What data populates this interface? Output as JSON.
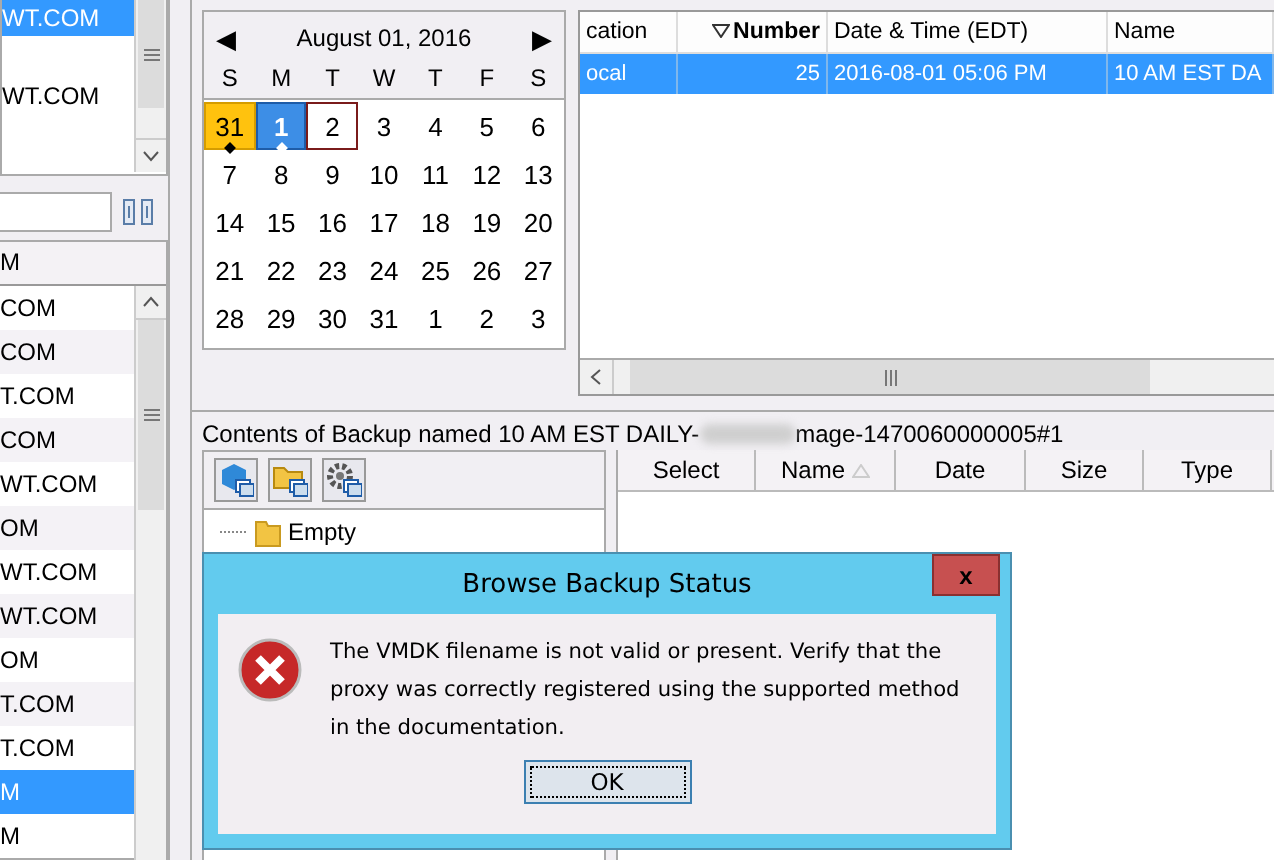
{
  "top_list": {
    "items": [
      {
        "text": "WT.COM",
        "selected": true
      },
      {
        "text": "WT.COM",
        "selected": false
      }
    ]
  },
  "side_table": {
    "columns": [
      "M"
    ],
    "rows": [
      {
        "text": "COM",
        "selected": false
      },
      {
        "text": "COM",
        "selected": false
      },
      {
        "text": "T.COM",
        "selected": false
      },
      {
        "text": "COM",
        "selected": false
      },
      {
        "text": "WT.COM",
        "selected": false
      },
      {
        "text": "OM",
        "selected": false
      },
      {
        "text": "WT.COM",
        "selected": false
      },
      {
        "text": "WT.COM",
        "selected": false
      },
      {
        "text": "OM",
        "selected": false
      },
      {
        "text": "T.COM",
        "selected": false
      },
      {
        "text": "T.COM",
        "selected": false
      },
      {
        "text": "M",
        "selected": true
      },
      {
        "text": "M",
        "selected": false
      }
    ]
  },
  "calendar": {
    "prev": "◀",
    "title": "August 01, 2016",
    "next": "▶",
    "weekdays": [
      "S",
      "M",
      "T",
      "W",
      "T",
      "F",
      "S"
    ],
    "days": [
      {
        "text": "31",
        "selected": false,
        "has_backup": true,
        "today": false
      },
      {
        "text": "1",
        "selected": true,
        "has_backup": true,
        "today": false
      },
      {
        "text": "2",
        "selected": false,
        "has_backup": false,
        "today": true
      },
      {
        "text": "3",
        "selected": false,
        "has_backup": false,
        "today": false
      },
      {
        "text": "4",
        "selected": false,
        "has_backup": false,
        "today": false
      },
      {
        "text": "5",
        "selected": false,
        "has_backup": false,
        "today": false
      },
      {
        "text": "6",
        "selected": false,
        "has_backup": false,
        "today": false
      },
      {
        "text": "7",
        "selected": false,
        "has_backup": false,
        "today": false
      },
      {
        "text": "8",
        "selected": false,
        "has_backup": false,
        "today": false
      },
      {
        "text": "9",
        "selected": false,
        "has_backup": false,
        "today": false
      },
      {
        "text": "10",
        "selected": false,
        "has_backup": false,
        "today": false
      },
      {
        "text": "11",
        "selected": false,
        "has_backup": false,
        "today": false
      },
      {
        "text": "12",
        "selected": false,
        "has_backup": false,
        "today": false
      },
      {
        "text": "13",
        "selected": false,
        "has_backup": false,
        "today": false
      },
      {
        "text": "14",
        "selected": false,
        "has_backup": false,
        "today": false
      },
      {
        "text": "15",
        "selected": false,
        "has_backup": false,
        "today": false
      },
      {
        "text": "16",
        "selected": false,
        "has_backup": false,
        "today": false
      },
      {
        "text": "17",
        "selected": false,
        "has_backup": false,
        "today": false
      },
      {
        "text": "18",
        "selected": false,
        "has_backup": false,
        "today": false
      },
      {
        "text": "19",
        "selected": false,
        "has_backup": false,
        "today": false
      },
      {
        "text": "20",
        "selected": false,
        "has_backup": false,
        "today": false
      },
      {
        "text": "21",
        "selected": false,
        "has_backup": false,
        "today": false
      },
      {
        "text": "22",
        "selected": false,
        "has_backup": false,
        "today": false
      },
      {
        "text": "23",
        "selected": false,
        "has_backup": false,
        "today": false
      },
      {
        "text": "24",
        "selected": false,
        "has_backup": false,
        "today": false
      },
      {
        "text": "25",
        "selected": false,
        "has_backup": false,
        "today": false
      },
      {
        "text": "26",
        "selected": false,
        "has_backup": false,
        "today": false
      },
      {
        "text": "27",
        "selected": false,
        "has_backup": false,
        "today": false
      },
      {
        "text": "28",
        "selected": false,
        "has_backup": false,
        "today": false
      },
      {
        "text": "29",
        "selected": false,
        "has_backup": false,
        "today": false
      },
      {
        "text": "30",
        "selected": false,
        "has_backup": false,
        "today": false
      },
      {
        "text": "31",
        "selected": false,
        "has_backup": false,
        "today": false
      },
      {
        "text": "1",
        "selected": false,
        "has_backup": false,
        "today": false
      },
      {
        "text": "2",
        "selected": false,
        "has_backup": false,
        "today": false
      },
      {
        "text": "3",
        "selected": false,
        "has_backup": false,
        "today": false
      }
    ]
  },
  "backups_table": {
    "columns": [
      {
        "label": "cation",
        "kind": "plain"
      },
      {
        "label": "Number",
        "kind": "sort-desc"
      },
      {
        "label": "Date & Time (EDT)",
        "kind": "plain"
      },
      {
        "label": "Name",
        "kind": "plain"
      }
    ],
    "rows": [
      {
        "cells": [
          "ocal",
          "25",
          "2016-08-01 05:06 PM",
          "10 AM EST DA"
        ],
        "selected": true
      }
    ]
  },
  "contents": {
    "label_start": "Contents of Backup named 10 AM EST DAILY-",
    "label_end": "mage-1470060000005#1",
    "toolbar": [
      {
        "kind": "cube"
      },
      {
        "kind": "folder"
      },
      {
        "kind": "gear"
      }
    ],
    "tree": [
      {
        "label": "Empty"
      }
    ],
    "columns": [
      {
        "label": "Select",
        "kind": "plain"
      },
      {
        "label": "Name",
        "kind": "sort-asc"
      },
      {
        "label": "Date",
        "kind": "plain"
      },
      {
        "label": "Size",
        "kind": "plain"
      },
      {
        "label": "Type",
        "kind": "plain"
      }
    ]
  },
  "dialog": {
    "title": "Browse Backup Status",
    "close": "x",
    "message": "The VMDK filename is not valid or present. Verify that the proxy was correctly registered using the supported method in the documentation.",
    "button": "OK"
  }
}
